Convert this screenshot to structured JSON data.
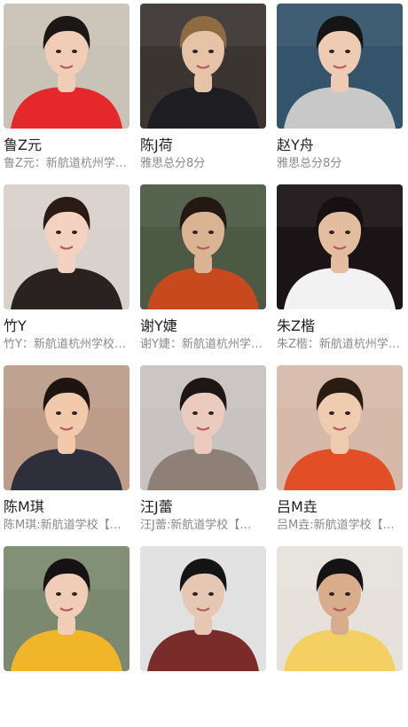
{
  "students": [
    {
      "name": "鲁Z元",
      "desc": "鲁Z元：新航道杭州学校…",
      "bg": "#c9c2b6",
      "shirt": "#e5282b",
      "skin": "#f1cdb7",
      "hair": "#1b1716",
      "photo": "girl-red-jacket-photo"
    },
    {
      "name": "陈J荷",
      "desc": "雅思总分8分",
      "bg": "#3b3532",
      "shirt": "#1d1d22",
      "skin": "#e6c2a6",
      "hair": "#8f6b44",
      "photo": "girl-suit-photo"
    },
    {
      "name": "赵Y舟",
      "desc": "雅思总分8分",
      "bg": "#33546b",
      "shirt": "#c8c8c8",
      "skin": "#efcbb4",
      "hair": "#151515",
      "photo": "boy-glasses-photo"
    },
    {
      "name": "竹Y",
      "desc": "竹Y：新航道杭州学校…",
      "bg": "#d9d1cb",
      "shirt": "#2a2221",
      "skin": "#f4d2c1",
      "hair": "#2a1b15",
      "photo": "girl-choker-photo"
    },
    {
      "name": "谢Y婕",
      "desc": "谢Y婕：新航道杭州学校…",
      "bg": "#4c5a43",
      "shirt": "#c9491f",
      "skin": "#dab393",
      "hair": "#241812",
      "photo": "girl-scarf-photo"
    },
    {
      "name": "朱Z楷",
      "desc": "朱Z楷：新航道杭州学校…",
      "bg": "#1b1416",
      "shirt": "#f2f2f2",
      "skin": "#e4bda0",
      "hair": "#161010",
      "photo": "boy-podium-photo"
    },
    {
      "name": "陈M琪",
      "desc": "陈M琪:新航道学校【…",
      "bg": "#bd9d8a",
      "shirt": "#2d2f3a",
      "skin": "#f2c9aa",
      "hair": "#1f1510",
      "photo": "girl-portrait-photo"
    },
    {
      "name": "汪J蕾",
      "desc": "汪J蕾:新航道学校【…",
      "bg": "#c8c3c0",
      "shirt": "#8e8077",
      "skin": "#eccbbf",
      "hair": "#1d1614",
      "photo": "girl-peace-sign-photo"
    },
    {
      "name": "吕M垚",
      "desc": "吕M垚:新航道学校【…",
      "bg": "#d7b9a9",
      "shirt": "#e24f26",
      "skin": "#efcbb0",
      "hair": "#2a1c13",
      "photo": "girl-straw-hat-photo"
    },
    {
      "name": "",
      "desc": "",
      "bg": "#7b8a6e",
      "shirt": "#f1b52a",
      "skin": "#f0cdb6",
      "hair": "#161112",
      "photo": "girl-yellow-jacket-photo"
    },
    {
      "name": "",
      "desc": "",
      "bg": "#e1e1e1",
      "shirt": "#7a2c2a",
      "skin": "#e6c7b4",
      "hair": "#141414",
      "photo": "boy-glasses-photo-2"
    },
    {
      "name": "",
      "desc": "",
      "bg": "#e6e2db",
      "shirt": "#f4d063",
      "skin": "#d8ad8c",
      "hair": "#151313",
      "photo": "boy-yellow-shirt-photo"
    }
  ]
}
